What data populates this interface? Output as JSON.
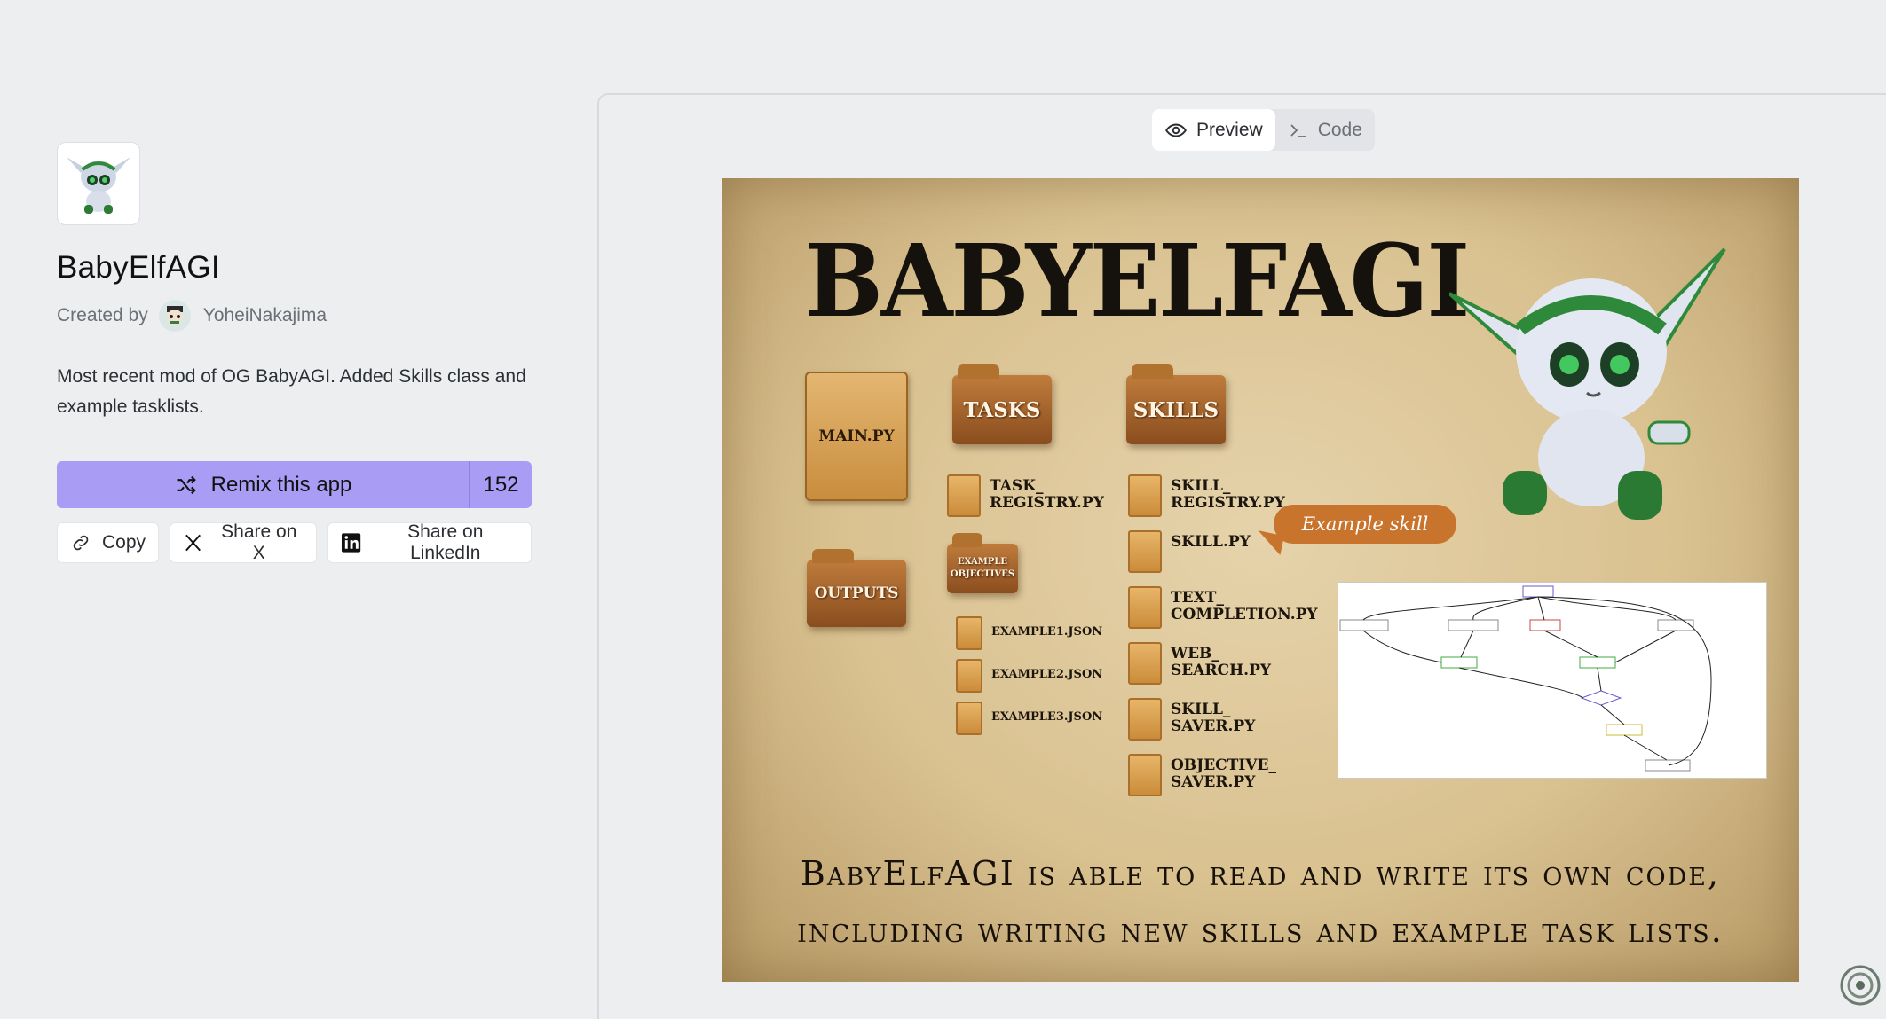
{
  "app": {
    "title": "BabyElfAGI",
    "created_by_label": "Created by",
    "author": "YoheiNakajima",
    "description": "Most recent mod of OG BabyAGI. Added Skills class and example tasklists.",
    "remix_label": "Remix this app",
    "remix_count": "152",
    "accent": "#a99cf5"
  },
  "share": {
    "copy": "Copy",
    "x": "Share on X",
    "linkedin": "Share on LinkedIn"
  },
  "toggle": {
    "preview": "Preview",
    "code": "Code"
  },
  "preview": {
    "title": "BABYELFAGI",
    "main_file": "MAIN.PY",
    "outputs": "OUTPUTS",
    "tasks": "TASKS",
    "skills": "SKILLS",
    "example_objectives": "EXAMPLE\nOBJECTIVES",
    "task_files": [
      "TASK_\nREGISTRY.PY"
    ],
    "example_files": [
      "EXAMPLE1.JSON",
      "EXAMPLE2.JSON",
      "EXAMPLE3.JSON"
    ],
    "skill_files": [
      "SKILL_\nREGISTRY.PY",
      "SKILL.PY",
      "TEXT_\nCOMPLETION.PY",
      "WEB_\nSEARCH.PY",
      "SKILL_\nSAVER.PY",
      "OBJECTIVE_\nSAVER.PY"
    ],
    "bubble": "Example skill",
    "caption_line1": "BabyElfAGI is able to read and write its own code,",
    "caption_line2": "including writing new skills and example task lists."
  },
  "icons": [
    "shuffle-icon",
    "link-icon",
    "x-logo-icon",
    "linkedin-icon",
    "eye-icon",
    "terminal-icon"
  ]
}
